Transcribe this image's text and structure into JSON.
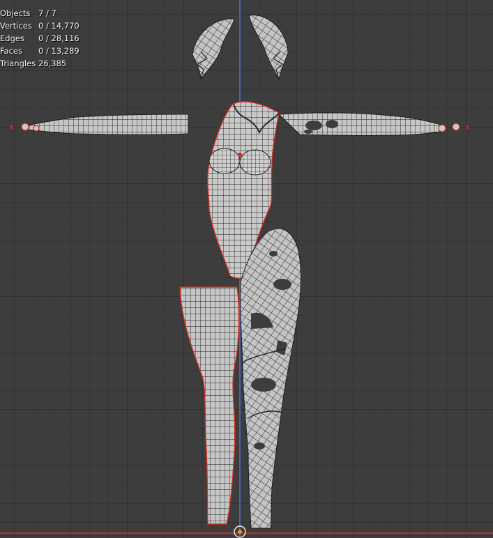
{
  "overlay": {
    "stats": [
      {
        "label": "Objects",
        "value": "7 / 7"
      },
      {
        "label": "Vertices",
        "value": "0 / 14,770"
      },
      {
        "label": "Edges",
        "value": "0 / 28,116"
      },
      {
        "label": "Faces",
        "value": "0 / 13,289"
      },
      {
        "label": "Triangles",
        "value": "26,385"
      }
    ]
  },
  "colors": {
    "viewport_bg": "#3d3d3d",
    "grid_major": "#303030",
    "grid_minor": "#363636",
    "z_axis": "#4f6fd0",
    "x_axis": "#c0392b",
    "mesh_fill": "#c9c9c9",
    "wire": "#1e1e1e",
    "selection_outline": "#d42a1d",
    "origin": "#ff8c1a",
    "stats_text": "#f2f2f2"
  },
  "scene": {
    "view": "front",
    "shading": "wireframe overlay",
    "objects": [
      "hair-left",
      "hair-right",
      "arm-left",
      "arm-right",
      "torso",
      "leg-left",
      "leg-right-armor"
    ]
  }
}
